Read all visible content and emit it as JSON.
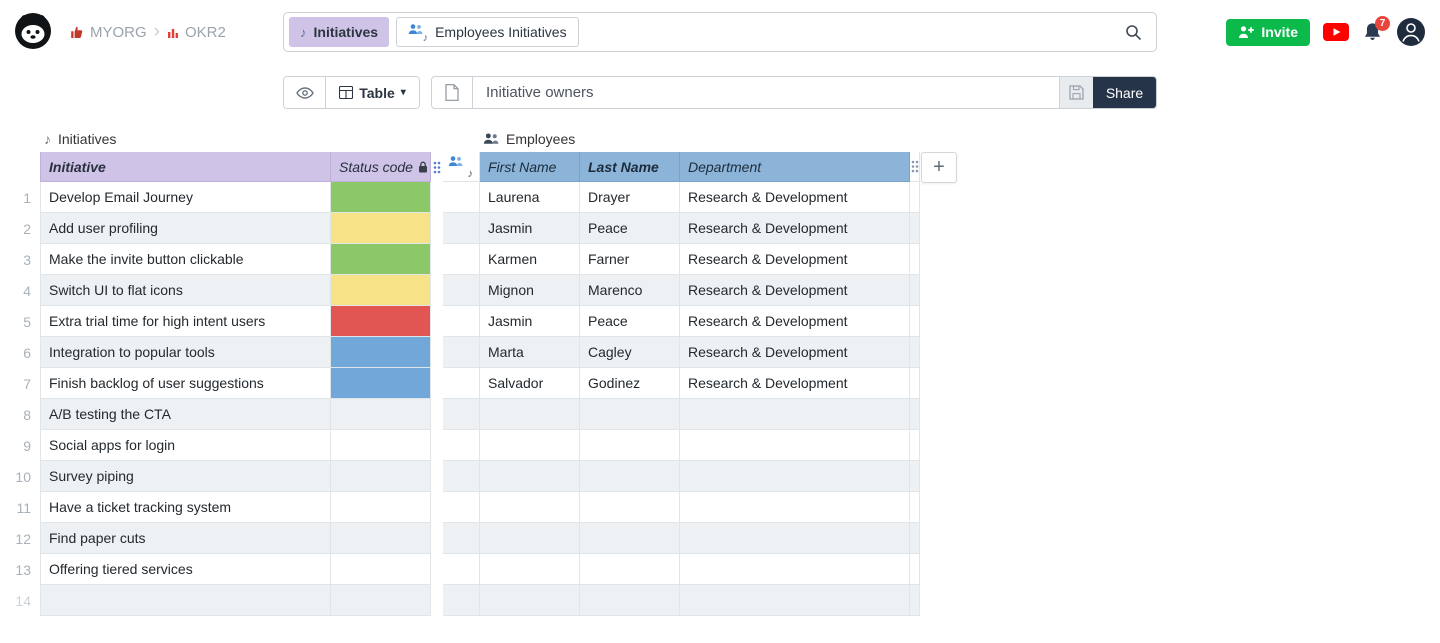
{
  "topbar": {
    "org": "MYORG",
    "workspace": "OKR2",
    "tabs": [
      {
        "label": "Initiatives",
        "active": true
      },
      {
        "label": "Employees Initiatives",
        "active": false
      }
    ],
    "invite_label": "Invite",
    "notification_count": "7"
  },
  "toolbar": {
    "view_type": "Table",
    "view_title": "Initiative owners",
    "share_label": "Share"
  },
  "sections": {
    "left_title": "Initiatives",
    "right_title": "Employees"
  },
  "columns": {
    "initiative": "Initiative",
    "status": "Status code",
    "first": "First Name",
    "last": "Last Name",
    "dept": "Department"
  },
  "add_column_label": "+",
  "icons": {
    "music_note": "♪",
    "chevron": "›",
    "caret_down": "▾"
  },
  "colors": {
    "status_green": "#8dc868",
    "status_yellow": "#f8e287",
    "status_red": "#e15552",
    "status_blue": "#72a7da",
    "header_purple": "#d0c3e8",
    "header_blue": "#8cb3d8",
    "invite_green": "#0cba4c",
    "share_navy": "#263449"
  },
  "rows": [
    {
      "num": "1",
      "initiative": "Develop Email Journey",
      "status": "green",
      "first": "Laurena",
      "last": "Drayer",
      "dept": "Research & Development"
    },
    {
      "num": "2",
      "initiative": "Add user profiling",
      "status": "yellow",
      "first": "Jasmin",
      "last": "Peace",
      "dept": "Research & Development"
    },
    {
      "num": "3",
      "initiative": "Make the invite button clickable",
      "status": "green",
      "first": "Karmen",
      "last": "Farner",
      "dept": "Research & Development"
    },
    {
      "num": "4",
      "initiative": "Switch UI to flat icons",
      "status": "yellow",
      "first": "Mignon",
      "last": "Marenco",
      "dept": "Research & Development"
    },
    {
      "num": "5",
      "initiative": "Extra trial time for high intent users",
      "status": "red",
      "first": "Jasmin",
      "last": "Peace",
      "dept": "Research & Development"
    },
    {
      "num": "6",
      "initiative": "Integration to popular tools",
      "status": "blue",
      "first": "Marta",
      "last": "Cagley",
      "dept": "Research & Development"
    },
    {
      "num": "7",
      "initiative": "Finish backlog of user suggestions",
      "status": "blue",
      "first": "Salvador",
      "last": "Godinez",
      "dept": "Research & Development"
    },
    {
      "num": "8",
      "initiative": "A/B testing the CTA",
      "status": "",
      "first": "",
      "last": "",
      "dept": ""
    },
    {
      "num": "9",
      "initiative": "Social apps for login",
      "status": "",
      "first": "",
      "last": "",
      "dept": ""
    },
    {
      "num": "10",
      "initiative": "Survey piping",
      "status": "",
      "first": "",
      "last": "",
      "dept": ""
    },
    {
      "num": "11",
      "initiative": "Have a ticket tracking system",
      "status": "",
      "first": "",
      "last": "",
      "dept": ""
    },
    {
      "num": "12",
      "initiative": "Find paper cuts",
      "status": "",
      "first": "",
      "last": "",
      "dept": ""
    },
    {
      "num": "13",
      "initiative": "Offering tiered services",
      "status": "",
      "first": "",
      "last": "",
      "dept": ""
    },
    {
      "num": "14",
      "initiative": "",
      "status": "",
      "first": "",
      "last": "",
      "dept": ""
    }
  ]
}
